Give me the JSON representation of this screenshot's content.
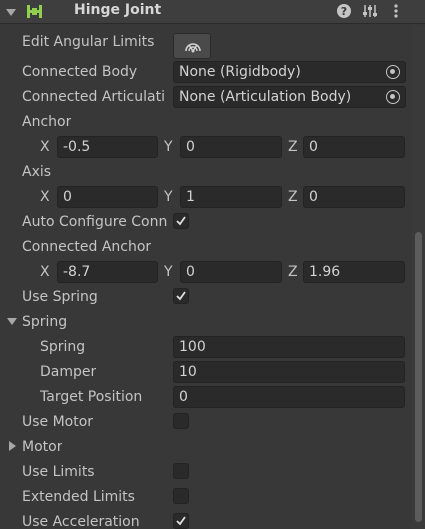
{
  "header": {
    "title": "Hinge Joint"
  },
  "rows": {
    "edit_angular_limits": "Edit Angular Limits",
    "connected_body": {
      "label": "Connected Body",
      "value": "None (Rigidbody)"
    },
    "connected_articulation": {
      "label": "Connected Articulati",
      "value": "None (Articulation Body)"
    },
    "anchor": {
      "label": "Anchor",
      "x": "-0.5",
      "y": "0",
      "z": "0"
    },
    "axis": {
      "label": "Axis",
      "x": "0",
      "y": "1",
      "z": "0"
    },
    "auto_configure": {
      "label": "Auto Configure Conn",
      "checked": true
    },
    "connected_anchor": {
      "label": "Connected Anchor",
      "x": "-8.7",
      "y": "0",
      "z": "1.96"
    },
    "use_spring": {
      "label": "Use Spring",
      "checked": true
    },
    "spring_section": {
      "label": "Spring",
      "spring": {
        "label": "Spring",
        "value": "100"
      },
      "damper": {
        "label": "Damper",
        "value": "10"
      },
      "target_position": {
        "label": "Target Position",
        "value": "0"
      }
    },
    "use_motor": {
      "label": "Use Motor",
      "checked": false
    },
    "motor_section": {
      "label": "Motor"
    },
    "use_limits": {
      "label": "Use Limits",
      "checked": false
    },
    "extended_limits": {
      "label": "Extended Limits",
      "checked": false
    },
    "use_acceleration": {
      "label": "Use Acceleration",
      "checked": true
    }
  },
  "axis_letters": {
    "x": "X",
    "y": "Y",
    "z": "Z"
  },
  "colors": {
    "background": "#383838",
    "field": "#2a2a2a",
    "text": "#c4c4c4",
    "icon_green": "#8fd14f"
  }
}
